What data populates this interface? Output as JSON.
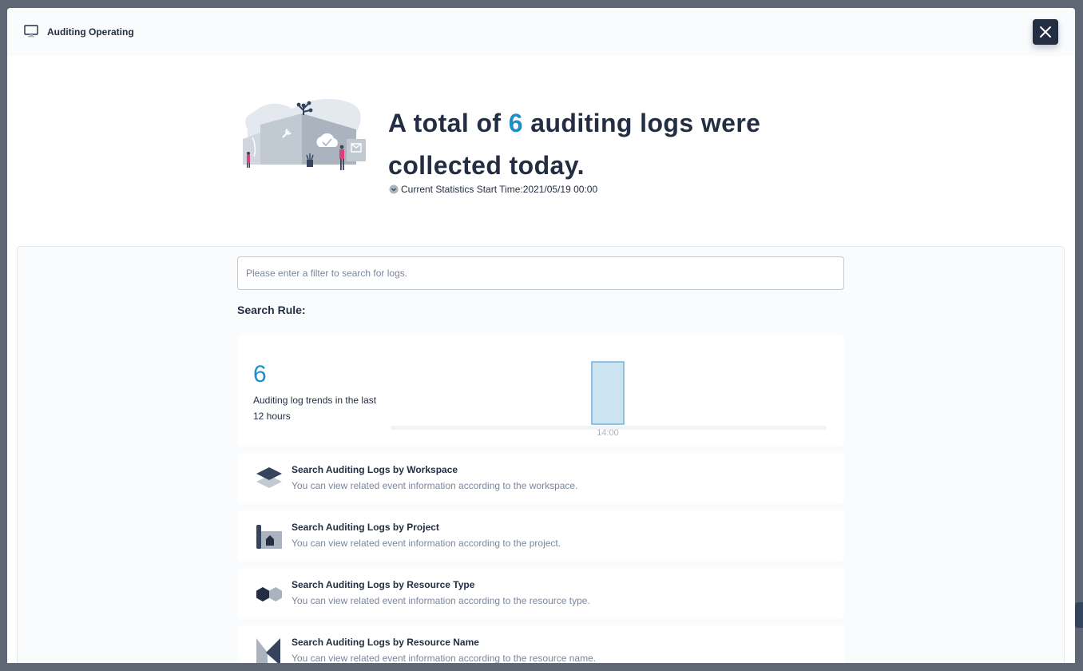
{
  "modal": {
    "title": "Auditing Operating",
    "close_label": "Close"
  },
  "hero": {
    "headline_prefix": "A total of ",
    "count": "6",
    "headline_suffix": " auditing logs were collected today.",
    "stats_start_label": "Current Statistics Start Time:2021/05/19 00:00"
  },
  "search": {
    "placeholder": "Please enter a filter to search for logs.",
    "value": "",
    "rule_label": "Search Rule:"
  },
  "trend": {
    "count": "6",
    "description": "Auditing log trends in the last 12 hours"
  },
  "chart_data": {
    "type": "bar",
    "categories": [
      "14:00"
    ],
    "values": [
      6
    ],
    "title": "",
    "xlabel": "",
    "ylabel": "",
    "ylim": [
      0,
      6
    ],
    "grid": false,
    "colors": {
      "bar_fill": "#cce4f2",
      "bar_stroke": "#6fb3dc",
      "baseline": "#eff4f9",
      "tick": "#abb4be"
    }
  },
  "rules": [
    {
      "icon": "workspace-icon",
      "title": "Search Auditing Logs by Workspace",
      "description": "You can view related event information according to the workspace."
    },
    {
      "icon": "project-icon",
      "title": "Search Auditing Logs by Project",
      "description": "You can view related event information according to the project."
    },
    {
      "icon": "resource-type-icon",
      "title": "Search Auditing Logs by Resource Type",
      "description": "You can view related event information according to the resource type."
    },
    {
      "icon": "resource-name-icon",
      "title": "Search Auditing Logs by Resource Name",
      "description": "You can view related event information according to the resource name."
    }
  ],
  "colors": {
    "accent": "#1c8fc8",
    "dark": "#242e42",
    "muted": "#79879c",
    "overlay": "#5f6774"
  }
}
